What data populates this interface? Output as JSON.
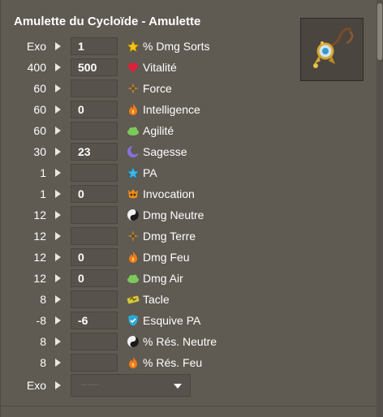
{
  "title": "Amulette du Cycloïde - Amulette",
  "rows": [
    {
      "base": "Exo",
      "value": "1",
      "label": "% Dmg Sorts",
      "icon": "star-icon",
      "color": "#f5c518"
    },
    {
      "base": "400",
      "value": "500",
      "label": "Vitalité",
      "icon": "heart-icon",
      "color": "#e0203a"
    },
    {
      "base": "60",
      "value": "",
      "label": "Force",
      "icon": "strength-icon",
      "color": "#b5853a"
    },
    {
      "base": "60",
      "value": "0",
      "label": "Intelligence",
      "icon": "fire-icon",
      "color": "#f07a1a"
    },
    {
      "base": "60",
      "value": "",
      "label": "Agilité",
      "icon": "cloud-icon",
      "color": "#7cc95b"
    },
    {
      "base": "30",
      "value": "23",
      "label": "Sagesse",
      "icon": "moon-icon",
      "color": "#8a6fe0"
    },
    {
      "base": "1",
      "value": "",
      "label": "PA",
      "icon": "star-blue-icon",
      "color": "#3bb7e8"
    },
    {
      "base": "1",
      "value": "0",
      "label": "Invocation",
      "icon": "invocation-icon",
      "color": "#e88a1a"
    },
    {
      "base": "12",
      "value": "",
      "label": "Dmg Neutre",
      "icon": "yin-yang-icon",
      "color": "#1a1a1a"
    },
    {
      "base": "12",
      "value": "",
      "label": "Dmg Terre",
      "icon": "strength-icon",
      "color": "#b5853a"
    },
    {
      "base": "12",
      "value": "0",
      "label": "Dmg Feu",
      "icon": "fire-icon",
      "color": "#f07a1a"
    },
    {
      "base": "12",
      "value": "0",
      "label": "Dmg Air",
      "icon": "cloud-icon",
      "color": "#7cc95b"
    },
    {
      "base": "8",
      "value": "",
      "label": "Tacle",
      "icon": "tackle-icon",
      "color": "#d7c73a"
    },
    {
      "base": "-8",
      "value": "-6",
      "label": "Esquive PA",
      "icon": "shield-icon",
      "color": "#2aa9d8"
    },
    {
      "base": "8",
      "value": "",
      "label": "% Rés. Neutre",
      "icon": "yin-yang-icon",
      "color": "#1a1a1a"
    },
    {
      "base": "8",
      "value": "",
      "label": "% Rés. Feu",
      "icon": "fire-icon",
      "color": "#f07a1a"
    }
  ],
  "exo_row": {
    "base": "Exo",
    "placeholder": "------"
  }
}
